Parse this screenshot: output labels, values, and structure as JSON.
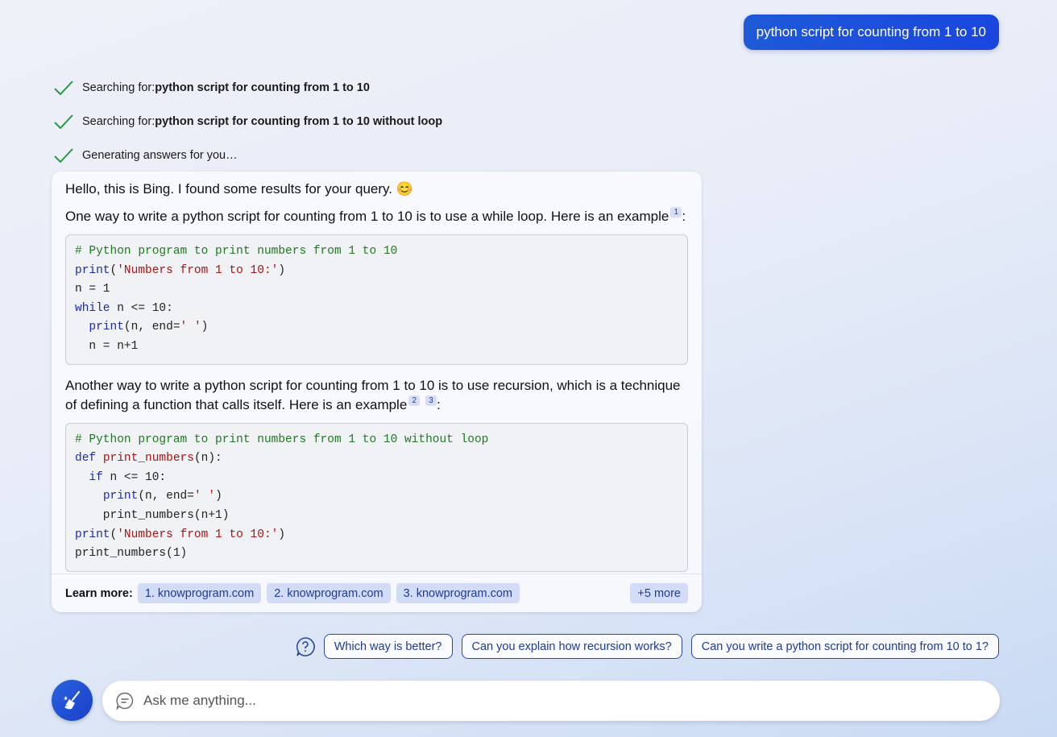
{
  "user_message": "python script for counting from 1 to 10",
  "status": [
    {
      "prefix": "Searching for: ",
      "query": "python script for counting from 1 to 10"
    },
    {
      "prefix": "Searching for: ",
      "query": "python script for counting from 1 to 10 without loop"
    },
    {
      "prefix": "Generating answers for you…",
      "query": ""
    }
  ],
  "answer": {
    "greeting": "Hello, this is Bing. I found some results for your query. 😊",
    "para1": "One way to write a python script for counting from 1 to 10 is to use a while loop. Here is an example",
    "para1_cites": [
      "1"
    ],
    "para2": "Another way to write a python script for counting from 1 to 10 is to use recursion, which is a technique of defining a function that calls itself. Here is an example",
    "para2_cites": [
      "2",
      "3"
    ],
    "colon": ":",
    "code1": [
      "# Python program to print numbers from 1 to 10",
      "print('Numbers from 1 to 10:')",
      "n = 1",
      "while n <= 10:",
      "  print(n, end=' ')",
      "  n = n+1"
    ],
    "code2": [
      "# Python program to print numbers from 1 to 10 without loop",
      "def print_numbers(n):",
      "  if n <= 10:",
      "    print(n, end=' ')",
      "    print_numbers(n+1)",
      "print('Numbers from 1 to 10:')",
      "print_numbers(1)"
    ]
  },
  "learn_more": {
    "label": "Learn more:",
    "sources": [
      "1. knowprogram.com",
      "2. knowprogram.com",
      "3. knowprogram.com"
    ],
    "more": "+5 more"
  },
  "suggestions": [
    "Which way is better?",
    "Can you explain how recursion works?",
    "Can you write a python script for counting from 10 to 1?"
  ],
  "input": {
    "placeholder": "Ask me anything..."
  },
  "icons": {
    "status": "checkmark-icon",
    "suggest": "question-bubble-icon",
    "new_topic": "broom-icon",
    "input": "chat-bubble-icon"
  },
  "colors": {
    "accent": "#1a46e0",
    "check": "#1f9a3a",
    "chip_bg": "#d3dcf6",
    "chip_text": "#1d3a9c"
  }
}
